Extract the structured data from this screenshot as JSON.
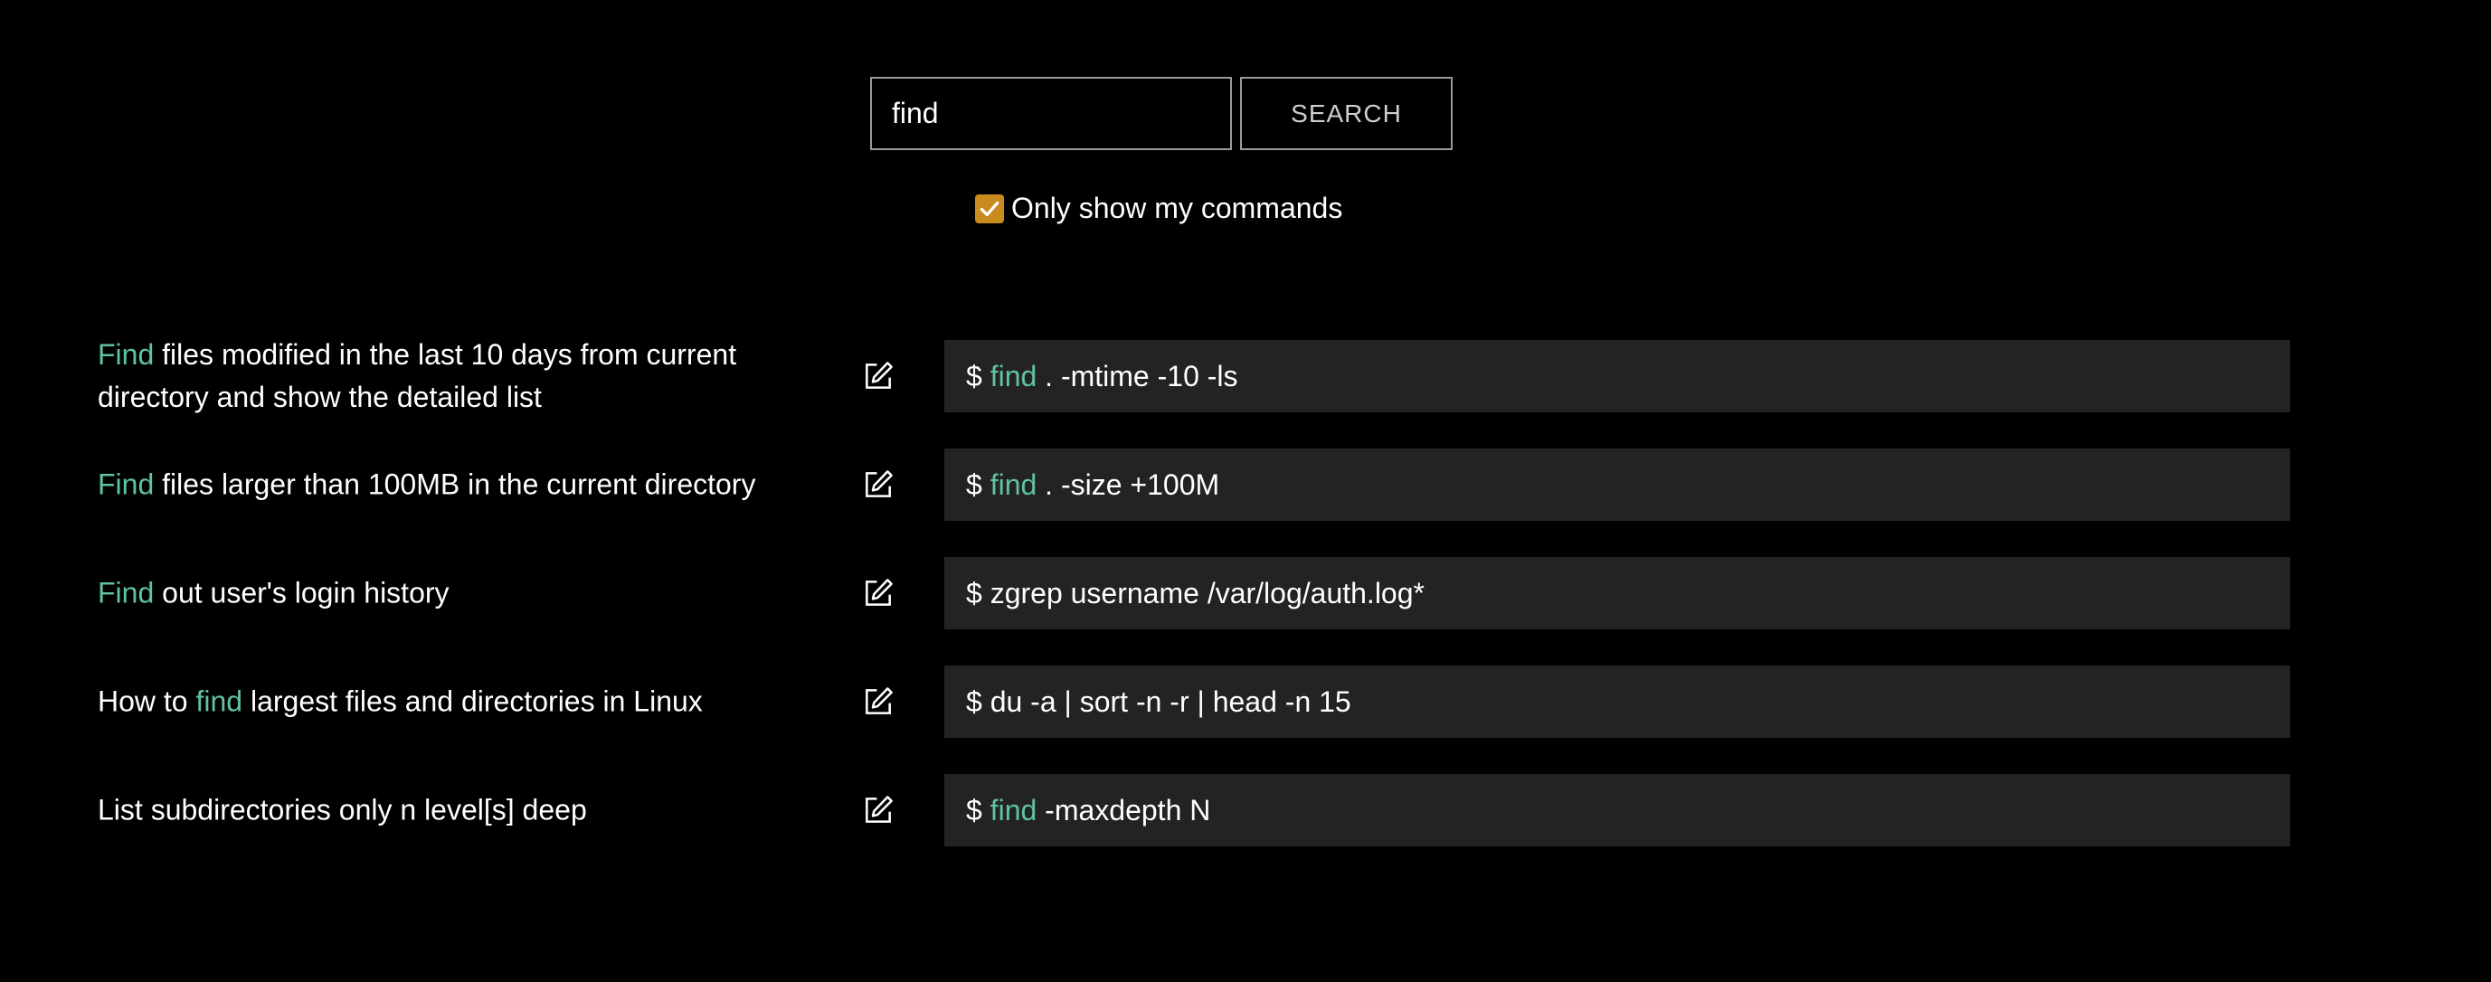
{
  "search": {
    "value": "find",
    "button_label": "SEARCH"
  },
  "filter": {
    "label": "Only show my commands",
    "checked": true
  },
  "colors": {
    "highlight": "#5fc39e",
    "checkbox": "#c98a1e",
    "command_bg": "#232323"
  },
  "icons": {
    "edit": "edit-icon",
    "check": "check-icon"
  },
  "results": [
    {
      "desc_pre": "",
      "desc_hl": "Find",
      "desc_post": " files modified in the last 10 days from current directory and show the detailed list",
      "cmd_prefix": "$ ",
      "cmd_hl": "find",
      "cmd_rest": " . -mtime -10 -ls"
    },
    {
      "desc_pre": "",
      "desc_hl": "Find",
      "desc_post": " files larger than 100MB in the current directory",
      "cmd_prefix": "$ ",
      "cmd_hl": "find",
      "cmd_rest": " . -size +100M"
    },
    {
      "desc_pre": "",
      "desc_hl": "Find",
      "desc_post": " out user's login history",
      "cmd_prefix": "$ ",
      "cmd_hl": "",
      "cmd_rest": "zgrep username /var/log/auth.log*"
    },
    {
      "desc_pre": "How to ",
      "desc_hl": "find",
      "desc_post": " largest files and directories in Linux",
      "cmd_prefix": "$ ",
      "cmd_hl": "",
      "cmd_rest": "du -a | sort -n -r | head -n 15"
    },
    {
      "desc_pre": "List subdirectories only n level[s] deep",
      "desc_hl": "",
      "desc_post": "",
      "cmd_prefix": "$ ",
      "cmd_hl": "find",
      "cmd_rest": " -maxdepth N"
    }
  ]
}
